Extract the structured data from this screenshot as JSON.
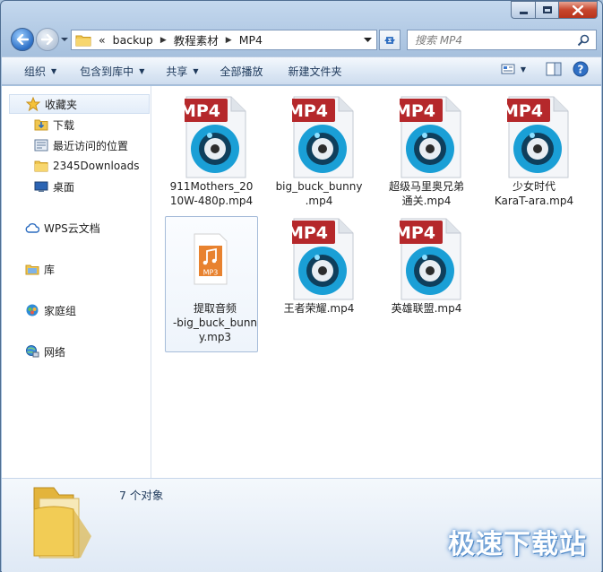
{
  "address": {
    "prefix": "«",
    "crumbs": [
      "backup",
      "教程素材",
      "MP4"
    ]
  },
  "search": {
    "placeholder": "搜索 MP4"
  },
  "toolbar": {
    "organize": "组织",
    "include_library": "包含到库中",
    "share": "共享",
    "play_all": "全部播放",
    "new_folder": "新建文件夹"
  },
  "sidebar": {
    "favorites": "收藏夹",
    "downloads": "下载",
    "recent": "最近访问的位置",
    "downloads2345": "2345Downloads",
    "desktop": "桌面",
    "wps": "WPS云文档",
    "library": "库",
    "homegroup": "家庭组",
    "network": "网络"
  },
  "files": [
    {
      "name": "911Mothers_2010W-480p.mp4",
      "line1": "911Mothers_20",
      "line2": "10W-480p.mp4",
      "badge": "MP4"
    },
    {
      "name": "big_buck_bunny.mp4",
      "line1": "big_buck_bunny",
      "line2": ".mp4",
      "badge": "MP4"
    },
    {
      "name": "超级马里奥兄弟通关.mp4",
      "line1": "超级马里奥兄弟",
      "line2": "通关.mp4",
      "badge": "MP4"
    },
    {
      "name": "少女时代KaraT-ara.mp4",
      "line1": "少女时代",
      "line2": "KaraT-ara.mp4",
      "badge": "MP4"
    },
    {
      "name": "提取音频-big_buck_bunny.mp3",
      "line1": "提取音频",
      "line2": "-big_buck_bunn",
      "line3": "y.mp3",
      "badge": "MP3"
    },
    {
      "name": "王者荣耀.mp4",
      "line1": "王者荣耀.mp4",
      "badge": "MP4"
    },
    {
      "name": "英雄联盟.mp4",
      "line1": "英雄联盟.mp4",
      "badge": "MP4"
    }
  ],
  "details": {
    "count": "7 个对象"
  },
  "watermark": "极速下载站",
  "colors": {
    "mp4_badge": "#b5282b",
    "mp3_badge": "#e8822f",
    "reel": "#1a9fd6"
  }
}
